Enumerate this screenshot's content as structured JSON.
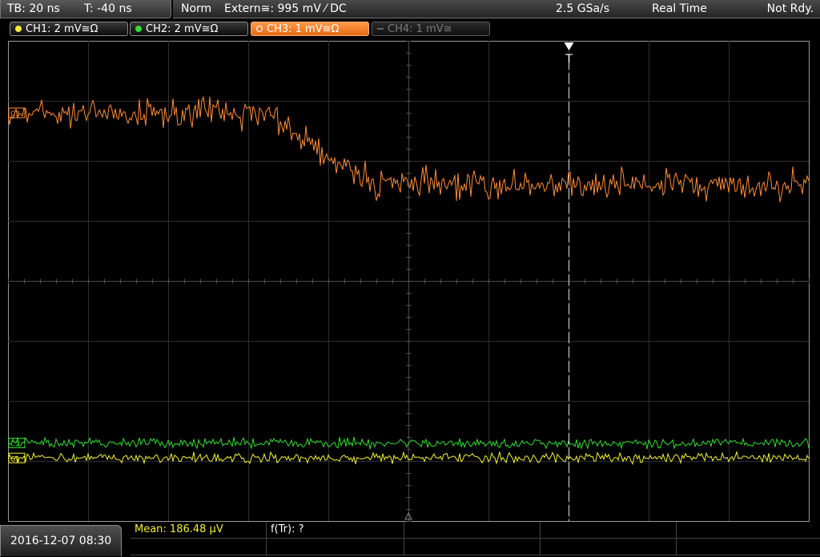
{
  "topbar": {
    "timebase": "TB: 20 ns",
    "trigger_offset": "T: -40 ns",
    "acq_mode": "Norm",
    "trigger_source": "Extern≅: 995 mV ⁄ DC",
    "sample_rate": "2.5 GSa/s",
    "acq_type": "Real Time",
    "status": "Not Rdy."
  },
  "channels": [
    {
      "label": "CH1: 2 mV≅Ω",
      "color": "#f2ef3a",
      "state": "on"
    },
    {
      "label": "CH2: 2 mV≅Ω",
      "color": "#33dd33",
      "state": "on"
    },
    {
      "label": "CH3: 1 mV≅Ω",
      "color": "#ff8c3a",
      "state": "active"
    },
    {
      "label": "CH4: 1 mV≅",
      "color": "#666666",
      "state": "off"
    }
  ],
  "plot": {
    "grid": {
      "cols": 10,
      "rows": 8
    },
    "trigger_marker": "T",
    "trigger_time_div": 2,
    "channel_markers": [
      "C1",
      "C2",
      "C3"
    ],
    "traces": [
      {
        "name": "CH3",
        "color": "#ff8c3a",
        "level_start_div": 1.2,
        "level_end_div": 2.4,
        "step_from_div": -1.8,
        "step_to_div": -0.4,
        "noise_div": 0.35
      },
      {
        "name": "CH2",
        "color": "#33dd33",
        "level_div": 6.7,
        "noise_div": 0.12
      },
      {
        "name": "CH1",
        "color": "#f2ef3a",
        "level_div": 6.95,
        "noise_div": 0.12
      }
    ]
  },
  "bottom": {
    "datetime": "2016-12-07 08:30",
    "mean": "Mean: 186.48 µV",
    "ftr": "f(Tr): ?"
  }
}
